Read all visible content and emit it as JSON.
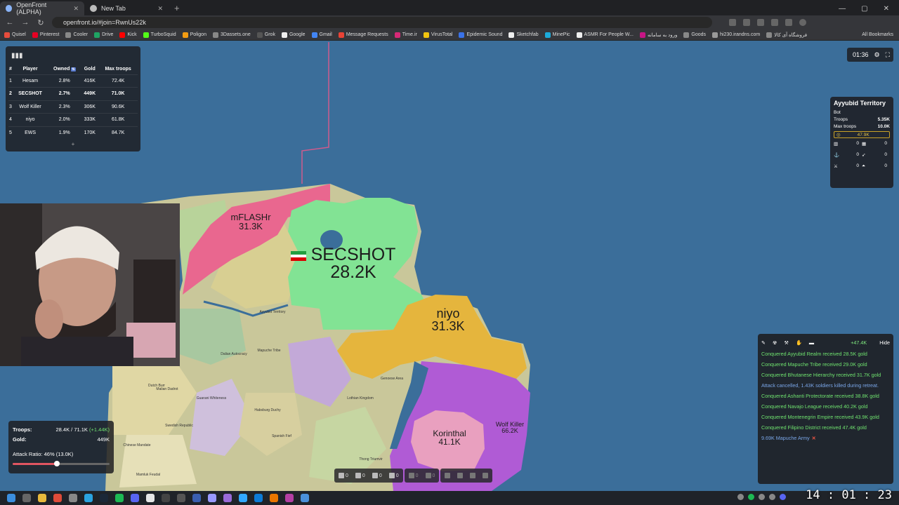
{
  "browser": {
    "tabs": [
      {
        "title": "OpenFront (ALPHA)",
        "active": true
      },
      {
        "title": "New Tab",
        "active": false
      }
    ],
    "url": "openfront.io/#join=RwnUs22k",
    "bookmarks": [
      "Quisel",
      "Pinterest",
      "Cooler",
      "Drive",
      "Kick",
      "TurboSquid",
      "Poligon",
      "3Dassets.one",
      "Grok",
      "Google",
      "Gmail",
      "Message Requests",
      "Time.ir",
      "VirusTotal",
      "Epidemic Sound",
      "Sketchfab",
      "MinePic",
      "ASMR For People W...",
      "ورود به سامانه",
      "Goods",
      "hi230.irandns.com",
      "فروشگاه آی کالا"
    ],
    "all_bookmarks_label": "All Bookmarks"
  },
  "leaderboard": {
    "icon": "bar-chart-icon",
    "headers": [
      "#",
      "Player",
      "Owned",
      "Gold",
      "Max troops"
    ],
    "owned_sort": "⇅",
    "rows": [
      {
        "rank": "1",
        "player": "Hesam",
        "owned": "2.8%",
        "gold": "416K",
        "max": "72.4K"
      },
      {
        "rank": "2",
        "player": "SECSHOT",
        "owned": "2.7%",
        "gold": "449K",
        "max": "71.0K"
      },
      {
        "rank": "3",
        "player": "Wolf Killer",
        "owned": "2.3%",
        "gold": "306K",
        "max": "90.6K"
      },
      {
        "rank": "4",
        "player": "niyo",
        "owned": "2.0%",
        "gold": "333K",
        "max": "61.8K"
      },
      {
        "rank": "5",
        "player": "EWS",
        "owned": "1.9%",
        "gold": "170K",
        "max": "84.7K"
      }
    ],
    "more": "+"
  },
  "timer": {
    "time": "01:36"
  },
  "territory": {
    "name": "Ayyubid Territory",
    "type": "Bot",
    "troops_label": "Troops",
    "troops": "5.35K",
    "max_troops_label": "Max troops",
    "max_troops": "10.0K",
    "gold": "47.9K",
    "counts": [
      "0",
      "0",
      "0",
      "0",
      "0",
      "0"
    ]
  },
  "events": {
    "gold_total": "+47.4K",
    "hide_label": "Hide",
    "items": [
      {
        "text": "Conquered Ayyubid Realm received 28.5K gold",
        "kind": "green"
      },
      {
        "text": "Conquered Mapuche Tribe received 29.0K gold",
        "kind": "green"
      },
      {
        "text": "Conquered Bhutanese Hierarchy received 31.7K gold",
        "kind": "green"
      },
      {
        "text": "Attack cancelled, 1.43K soldiers killed during retreat.",
        "kind": "blue"
      },
      {
        "text": "Conquered Ashanti Protectorate received 38.8K gold",
        "kind": "green"
      },
      {
        "text": "Conquered Navajo League received 40.2K gold",
        "kind": "green"
      },
      {
        "text": "Conquered Montenegrin Empire received 43.9K gold",
        "kind": "green"
      },
      {
        "text": "Conquered Filipino District received 47.4K gold",
        "kind": "green"
      }
    ],
    "last": "9.69K Mapuche Army",
    "last_close": "✕"
  },
  "player_stats": {
    "troops_label": "Troops:",
    "troops": "28.4K / 71.1K",
    "troops_inc": "(+1.44K)",
    "gold_label": "Gold:",
    "gold": "449K",
    "attack_ratio": "Attack Ratio: 46% (13.0K)",
    "attack_ratio_fraction": 0.46
  },
  "build_bar": {
    "counts": [
      "0",
      "0",
      "0",
      "0",
      "0",
      "0"
    ]
  },
  "map_labels": {
    "secshot_name": "SECSHOT",
    "secshot_troops": "28.2K",
    "niyo_name": "niyo",
    "niyo_troops": "31.3K",
    "flash_name": "mFLASHr",
    "flash_troops": "31.3K",
    "korinthal_name": "Korinthal",
    "korinthal_troops": "41.1K",
    "wolf_name": "Wolf Killer",
    "wolf_troops": "66.2K",
    "small": [
      {
        "t": "Ayyubid Territory"
      },
      {
        "t": "Mapuche Tribe"
      },
      {
        "t": "Dutch Burr"
      },
      {
        "t": "Malian Dadrot"
      },
      {
        "t": "Guarani Whiteness"
      },
      {
        "t": "Habsburg Duchy"
      },
      {
        "t": "Spanish Fief"
      },
      {
        "t": "Swedish Republic"
      },
      {
        "t": "Chinese Mandate"
      },
      {
        "t": "Thong Triumvir"
      },
      {
        "t": "Lothian Kingdom"
      },
      {
        "t": "Genoese Area"
      },
      {
        "t": "Dalian Autocracy"
      },
      {
        "t": "Mamluk Feudal"
      }
    ]
  },
  "clock": "14 : 01 : 23"
}
